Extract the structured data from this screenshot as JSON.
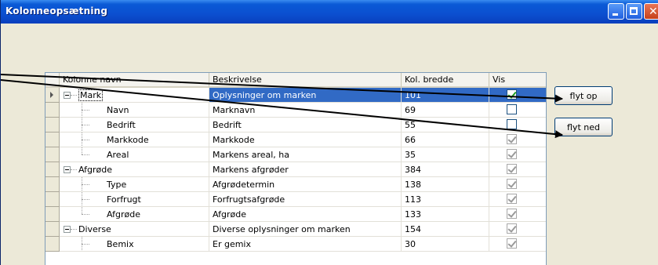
{
  "window": {
    "title": "Kolonneopsætning",
    "colors": {
      "titlebar": "#0a5ad6",
      "selection": "#316ac5"
    }
  },
  "grid": {
    "headers": {
      "navn": "Kolonne navn",
      "beskr": "Beskrivelse",
      "bredde": "Kol. bredde",
      "vis": "Vis"
    },
    "rows": [
      {
        "navn": "Mark",
        "beskr": "Oplysninger om marken",
        "bredde": "101",
        "vis": true
      },
      {
        "navn": "Navn",
        "beskr": "Marknavn",
        "bredde": "69",
        "vis": false
      },
      {
        "navn": "Bedrift",
        "beskr": "Bedrift",
        "bredde": "55",
        "vis": false
      },
      {
        "navn": "Markkode",
        "beskr": "Markkode",
        "bredde": "66",
        "vis": true
      },
      {
        "navn": "Areal",
        "beskr": "Markens areal, ha",
        "bredde": "35",
        "vis": true
      },
      {
        "navn": "Afgrøde",
        "beskr": "Markens afgrøder",
        "bredde": "384",
        "vis": true
      },
      {
        "navn": "Type",
        "beskr": "Afgrødetermin",
        "bredde": "138",
        "vis": true
      },
      {
        "navn": "Forfrugt",
        "beskr": "Forfrugtsafgrøde",
        "bredde": "113",
        "vis": true
      },
      {
        "navn": "Afgrøde",
        "beskr": "Afgrøde",
        "bredde": "133",
        "vis": true
      },
      {
        "navn": "Diverse",
        "beskr": "Diverse oplysninger om marken",
        "bredde": "154",
        "vis": true
      },
      {
        "navn": "Bemix",
        "beskr": "Er gemix",
        "bredde": "30",
        "vis": true
      }
    ]
  },
  "buttons": {
    "up": "flyt op",
    "down": "flyt ned"
  }
}
